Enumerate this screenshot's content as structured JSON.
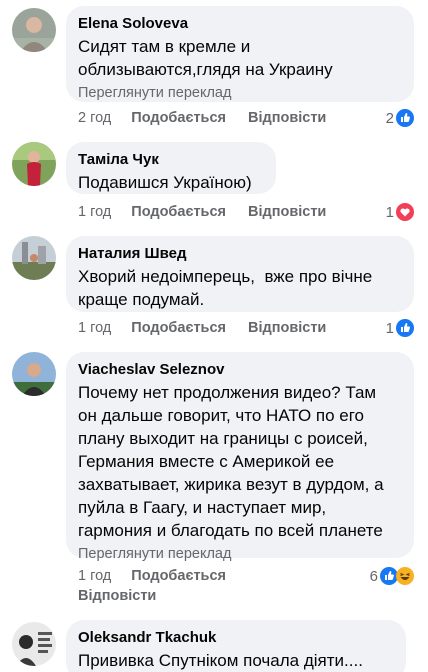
{
  "comments": [
    {
      "author": "Elena  Soloveva",
      "text": "Сидят там в кремле и\nоблизываются,глядя на Украину",
      "translate": "Переглянути переклад",
      "time": "2 год",
      "like": "Подобається",
      "reply": "Відповісти",
      "reaction_count": "2",
      "reactions": [
        "like-icon"
      ]
    },
    {
      "author": "Таміла Чук",
      "text": "Подавишся Україною)",
      "time": "1 год",
      "like": "Подобається",
      "reply": "Відповісти",
      "reaction_count": "1",
      "reactions": [
        "love-icon"
      ]
    },
    {
      "author": "Наталия Швед",
      "text": "Хворий недоімперець,  вже про вічне\nкраще подумай.",
      "time": "1 год",
      "like": "Подобається",
      "reply": "Відповісти",
      "reaction_count": "1",
      "reactions": [
        "like-icon"
      ]
    },
    {
      "author": "Viacheslav Seleznov",
      "text": "Почему нет продолжения видео? Там\nон дальше говорит, что НАТО по его\nплану выходит на границы с роисей,\nГермания вместе с Америкой ее\nзахватывает, жирика везут в дурдом, а\nпуйла в Гаагу, и наступает мир,\nгармония и благодать по всей планете",
      "translate": "Переглянути переклад",
      "time": "1 год",
      "like": "Подобається",
      "reply": "Відповісти",
      "reaction_count": "6",
      "reactions": [
        "like-icon",
        "haha-icon"
      ]
    },
    {
      "author": "Oleksandr Tkachuk",
      "text": "Прививка Спутніком почала діяти...."
    }
  ],
  "colors": {
    "bubble": "#f0f2f5",
    "secondary_text": "#65676b",
    "like_blue": "#1877f2",
    "love_red": "#f33e58",
    "haha_yellow": "#f7b125"
  }
}
